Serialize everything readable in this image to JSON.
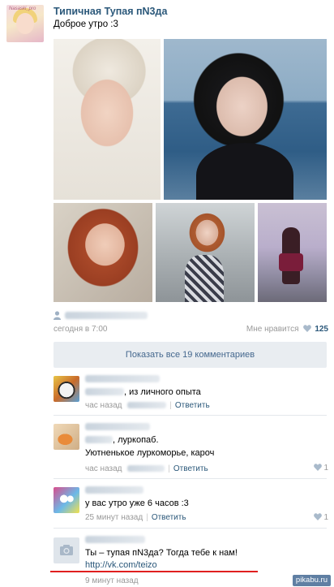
{
  "post": {
    "author": "Типичная Тупая пN3да",
    "avatar_tag": "Nasaski_pro",
    "text": "Доброе утро :3",
    "time": "сегодня в 7:00",
    "likes_label": "Мне нравится",
    "likes_count": "125",
    "show_all_comments": "Показать все 19 комментариев"
  },
  "comments": [
    {
      "text": ", из личного опыта",
      "time": "час назад",
      "reply": "Ответить"
    },
    {
      "text_line1": ", луркопаб.",
      "text_line2": "Уютненькое луркоморье, кароч",
      "time": "час назад",
      "reply": "Ответить",
      "likes": "1"
    },
    {
      "text": "у вас утро уже 6 часов :3",
      "time": "25 минут назад",
      "reply": "Ответить",
      "likes": "1"
    },
    {
      "text": "Ты – тупая пN3да? Тогда тебе к нам!",
      "link": "http://vk.com/teizo",
      "time": "9 минут назад"
    }
  ],
  "watermark": "pikabu.ru",
  "colors": {
    "link": "#2b587a",
    "button_bg": "#e9edf1",
    "muted": "#999999",
    "highlight": "#e01f1f"
  },
  "icons": [
    "user-icon",
    "heart-icon",
    "camera-icon"
  ]
}
